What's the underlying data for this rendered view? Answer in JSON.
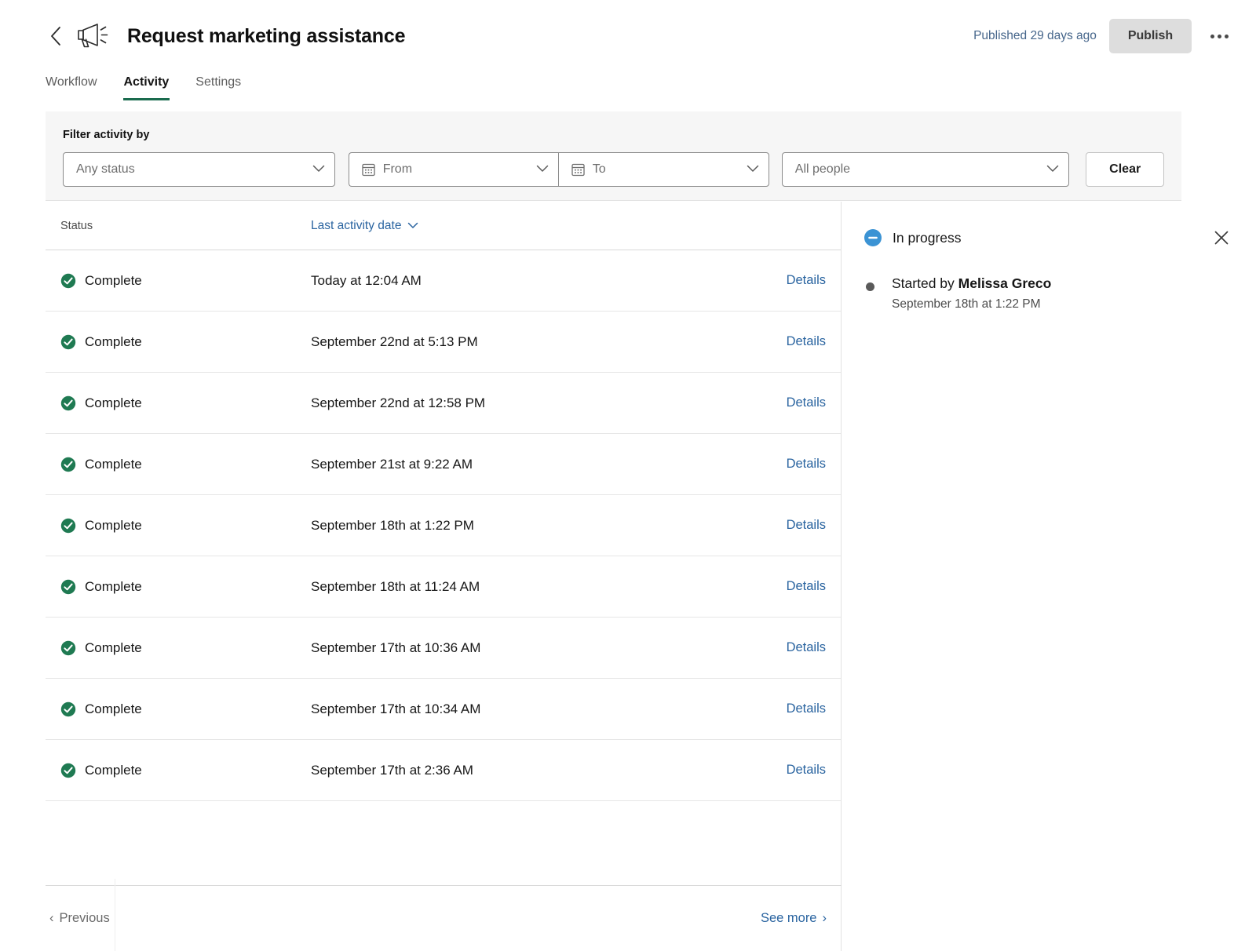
{
  "header": {
    "back_icon": "chevron-left-icon",
    "app_icon": "megaphone-icon",
    "title": "Request marketing assistance",
    "published_note": "Published 29 days ago",
    "publish_label": "Publish",
    "more_icon": "ellipsis-icon"
  },
  "tabs": [
    {
      "label": "Workflow",
      "active": false
    },
    {
      "label": "Activity",
      "active": true
    },
    {
      "label": "Settings",
      "active": false
    }
  ],
  "filters": {
    "label": "Filter activity by",
    "status": {
      "value": "Any status",
      "icon": "chevron-down-icon"
    },
    "from": {
      "value": "From",
      "icon": "calendar-icon"
    },
    "to": {
      "value": "To",
      "icon": "calendar-icon"
    },
    "people": {
      "value": "All people",
      "icon": "chevron-down-icon"
    },
    "clear_label": "Clear"
  },
  "table": {
    "columns": {
      "status": "Status",
      "date": "Last activity date",
      "date_sort_icon": "chevron-down-icon",
      "details": "Details"
    },
    "rows": [
      {
        "status": "Complete",
        "status_icon": "check-circle-icon",
        "date": "Today at 12:04 AM",
        "details": "Details"
      },
      {
        "status": "Complete",
        "status_icon": "check-circle-icon",
        "date": "September 22nd at 5:13 PM",
        "details": "Details"
      },
      {
        "status": "Complete",
        "status_icon": "check-circle-icon",
        "date": "September 22nd at 12:58 PM",
        "details": "Details"
      },
      {
        "status": "Complete",
        "status_icon": "check-circle-icon",
        "date": "September 21st at 9:22 AM",
        "details": "Details"
      },
      {
        "status": "Complete",
        "status_icon": "check-circle-icon",
        "date": "September 18th at 1:22 PM",
        "details": "Details"
      },
      {
        "status": "Complete",
        "status_icon": "check-circle-icon",
        "date": "September 18th at 11:24 AM",
        "details": "Details"
      },
      {
        "status": "Complete",
        "status_icon": "check-circle-icon",
        "date": "September 17th at 10:36 AM",
        "details": "Details"
      },
      {
        "status": "Complete",
        "status_icon": "check-circle-icon",
        "date": "September 17th at 10:34 AM",
        "details": "Details"
      },
      {
        "status": "Complete",
        "status_icon": "check-circle-icon",
        "date": "September 17th at 2:36 AM",
        "details": "Details"
      }
    ]
  },
  "pagination": {
    "previous_label": "Previous",
    "previous_chevron": "‹",
    "see_more_label": "See more",
    "see_more_chevron": "›"
  },
  "side_panel": {
    "status_label": "In progress",
    "status_icon": "minus-circle-icon",
    "close_icon": "close-icon",
    "entries": [
      {
        "prefix": "Started by ",
        "actor": "Melissa Greco",
        "timestamp": "September 18th at 1:22 PM"
      }
    ]
  },
  "colors": {
    "accent_green": "#1a6b4e",
    "complete_green": "#1f7a52",
    "in_progress_blue": "#3b93d4",
    "link_blue": "#2a64a0",
    "publish_bg": "#dddddd",
    "filterbar_bg": "#f6f6f6"
  }
}
